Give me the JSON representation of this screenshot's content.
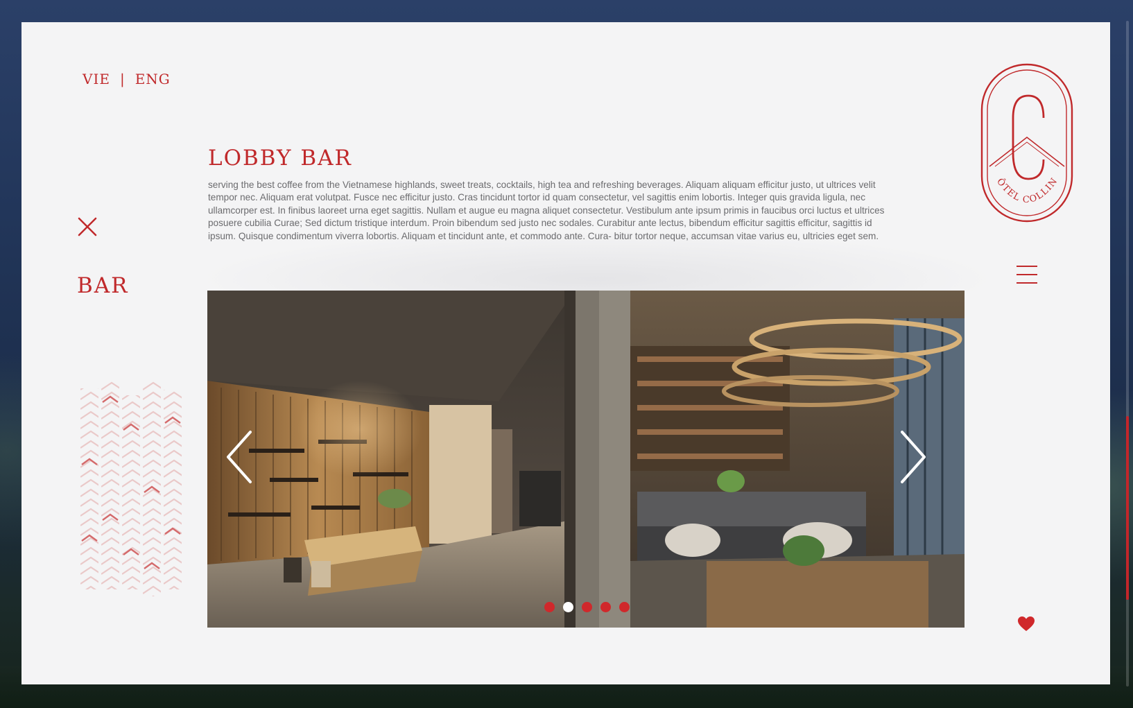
{
  "language_switch": {
    "options": [
      "VIE",
      "ENG"
    ],
    "separator": "|"
  },
  "section": {
    "label": "BAR"
  },
  "page": {
    "title": "LOBBY BAR",
    "description": "serving the best coffee from the Vietnamese highlands, sweet treats, cocktails, high tea and refreshing beverages. Aliquam aliquam efficitur justo, ut ultrices velit tempor nec. Aliquam erat volutpat. Fusce nec efficitur justo. Cras tincidunt tortor id quam consectetur, vel sagittis enim lobortis. Integer quis gravida ligula, nec ullamcorper est. In finibus laoreet urna eget sagittis. Nullam et augue eu magna aliquet consectetur. Vestibulum ante ipsum primis in faucibus orci luctus et ultrices posuere cubilia Curae; Sed dictum tristique interdum. Proin bibendum sed justo nec sodales. Curabitur ante lectus, bibendum efficitur sagittis efficitur, sagittis id ipsum. Quisque condimentum viverra lobortis. Aliquam et tincidunt ante, et commodo ante. Cura- bitur tortor neque, accumsan vitae varius eu, ultricies eget sem."
  },
  "logo": {
    "text": "HÔTEL COLLINE"
  },
  "carousel": {
    "slide_count": 5,
    "active_index": 1
  },
  "icons": {
    "close": "close-icon",
    "menu": "menu-icon",
    "favorite": "heart-icon",
    "prev": "chevron-left-icon",
    "next": "chevron-right-icon"
  },
  "colors": {
    "accent": "#c0292b",
    "panel_background": "#f4f4f5",
    "body_text": "#6b6b6e",
    "backdrop": "#1c2c49"
  }
}
